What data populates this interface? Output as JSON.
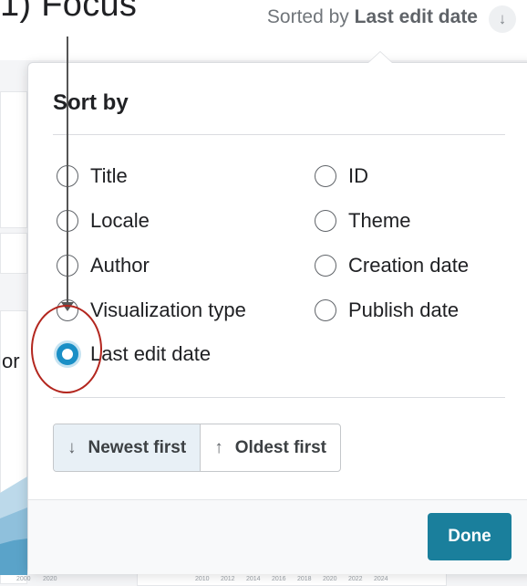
{
  "background": {
    "heading_fragment": "1) Focus",
    "sort_prefix": "Sorted by",
    "sort_value": "Last edit date",
    "sort_arrow": "↓",
    "side_text_fragment": "or",
    "axis_left": [
      "2000",
      "2020"
    ],
    "axis_right": [
      "2010",
      "2012",
      "2014",
      "2016",
      "2018",
      "2020",
      "2022",
      "2024"
    ]
  },
  "popover": {
    "title": "Sort by",
    "options_left": [
      {
        "label": "Title",
        "checked": false
      },
      {
        "label": "Locale",
        "checked": false
      },
      {
        "label": "Author",
        "checked": false
      },
      {
        "label": "Visualization type",
        "checked": false
      },
      {
        "label": "Last edit date",
        "checked": true
      }
    ],
    "options_right": [
      {
        "label": "ID",
        "checked": false
      },
      {
        "label": "Theme",
        "checked": false
      },
      {
        "label": "Creation date",
        "checked": false
      },
      {
        "label": "Publish date",
        "checked": false
      }
    ],
    "order": {
      "newest_label": "Newest first",
      "newest_icon": "arrow-down-icon",
      "oldest_label": "Oldest first",
      "oldest_icon": "arrow-up-icon",
      "selected": "newest"
    },
    "done_label": "Done"
  },
  "colors": {
    "accent": "#1a8fc6",
    "done_button": "#1a7f9c",
    "annotation_circle": "#b3261e"
  }
}
